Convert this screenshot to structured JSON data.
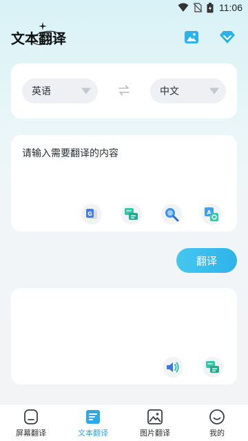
{
  "status_bar": {
    "time": "11:06"
  },
  "header": {
    "title": "文本翻译"
  },
  "languages": {
    "source": "英语",
    "target": "中文"
  },
  "input": {
    "placeholder": "请输入需要翻译的内容"
  },
  "translate_button": {
    "label": "翻译"
  },
  "bottom_nav": {
    "items": [
      {
        "label": "屏幕翻译",
        "icon": "screen-icon"
      },
      {
        "label": "文本翻译",
        "icon": "document-icon",
        "active": true
      },
      {
        "label": "图片翻译",
        "icon": "image-icon"
      },
      {
        "label": "我的",
        "icon": "smiley-icon"
      }
    ]
  },
  "colors": {
    "accent": "#2fb2ea",
    "teal": "#34c7a6",
    "background": "#e9f6f8"
  }
}
